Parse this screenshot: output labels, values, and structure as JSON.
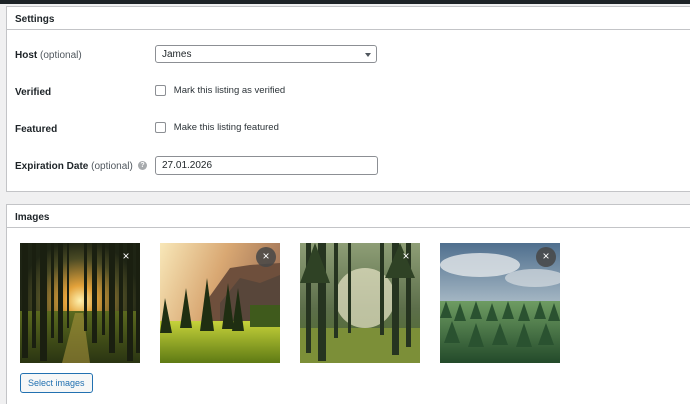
{
  "settings": {
    "title": "Settings",
    "host": {
      "label": "Host",
      "optional": "(optional)",
      "value": "James"
    },
    "verified": {
      "label": "Verified",
      "checkbox_label": "Mark this listing as verified"
    },
    "featured": {
      "label": "Featured",
      "checkbox_label": "Make this listing featured"
    },
    "expiration": {
      "label": "Expiration Date",
      "optional": "(optional)",
      "help_glyph": "?",
      "value": "27.01.2026"
    }
  },
  "images": {
    "title": "Images",
    "remove_glyph": "×",
    "select_button": "Select images",
    "items": [
      {
        "icon": "forest-sunset-image"
      },
      {
        "icon": "meadow-mountain-image"
      },
      {
        "icon": "forest-clearing-image"
      },
      {
        "icon": "forest-aerial-image"
      }
    ]
  }
}
